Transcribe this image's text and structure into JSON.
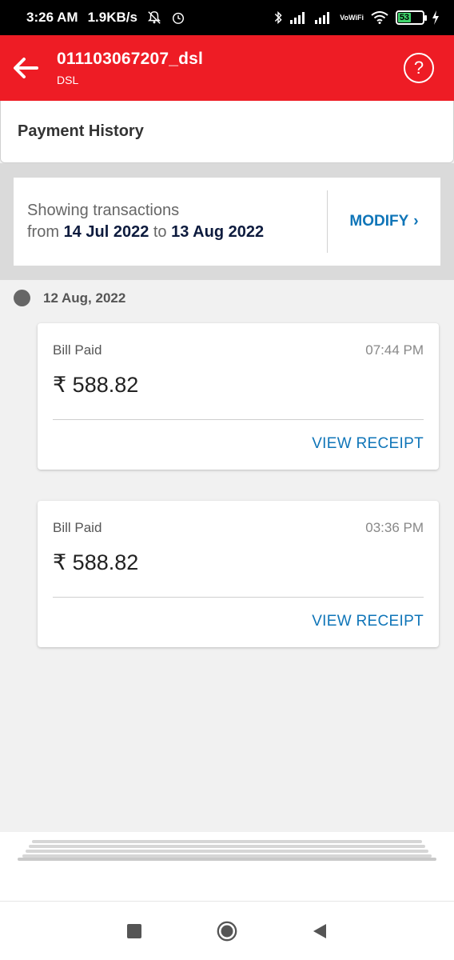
{
  "status_bar": {
    "time": "3:26 AM",
    "net_speed": "1.9KB/s",
    "vowifi_top": "Vo",
    "vowifi_bottom": "WiFi",
    "battery": "53",
    "icons": [
      "bell-off-icon",
      "alarm-icon",
      "bluetooth-icon",
      "signal-icon",
      "signal-icon",
      "vowifi-icon",
      "wifi-icon",
      "battery-icon",
      "charging-icon"
    ]
  },
  "app_bar": {
    "title": "011103067207_dsl",
    "subtitle": "DSL",
    "help": "?",
    "color": "#ee1c25"
  },
  "page": {
    "title": "Payment History"
  },
  "range": {
    "line1": "Showing transactions",
    "from_word": "from",
    "from_date": "14 Jul 2022",
    "to_word": "to",
    "to_date": "13 Aug 2022",
    "modify_label": "MODIFY",
    "modify_chevron": "›"
  },
  "timeline": {
    "date": "12 Aug, 2022",
    "transactions": [
      {
        "type": "Bill Paid",
        "time": "07:44 PM",
        "amount": "₹ 588.82",
        "action": "VIEW RECEIPT"
      },
      {
        "type": "Bill Paid",
        "time": "03:36 PM",
        "amount": "₹ 588.82",
        "action": "VIEW RECEIPT"
      }
    ]
  },
  "colors": {
    "accent_blue": "#0f75b8",
    "date_navy": "#0d1b3e"
  }
}
